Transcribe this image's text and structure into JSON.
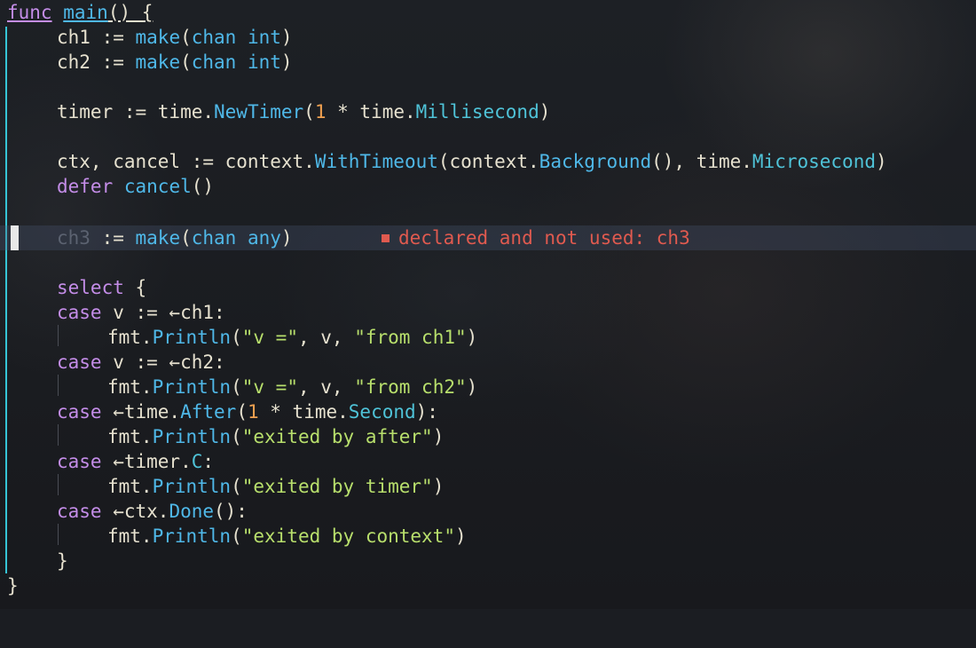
{
  "colors": {
    "background": "#1b1d22",
    "keyword": "#c48de8",
    "function": "#4fb8e8",
    "string": "#b8df6c",
    "number": "#f0a050",
    "error": "#e05a4f",
    "indent_guide": "#36c5d6",
    "current_line": "#3a4560"
  },
  "code": {
    "l0_kw": "func",
    "l0_fn": "main",
    "l0_rest": "() {",
    "l1_a": "ch1 := ",
    "l1_make": "make",
    "l1_b": "(",
    "l1_chan": "chan int",
    "l1_c": ")",
    "l2_a": "ch2 := ",
    "l2_make": "make",
    "l2_b": "(",
    "l2_chan": "chan int",
    "l2_c": ")",
    "l4_a": "timer := time.",
    "l4_fn": "NewTimer",
    "l4_b": "(",
    "l4_num": "1",
    "l4_c": " * time.",
    "l4_meth": "Millisecond",
    "l4_d": ")",
    "l6_a": "ctx, cancel := context.",
    "l6_fn": "WithTimeout",
    "l6_b": "(context.",
    "l6_fn2": "Background",
    "l6_c": "(), time.",
    "l6_meth": "Microsecond",
    "l6_d": ")",
    "l7_kw": "defer",
    "l7_fn": "cancel",
    "l7_rest": "()",
    "l9_unused": "ch3",
    "l9_a": " := ",
    "l9_make": "make",
    "l9_b": "(",
    "l9_chan": "chan any",
    "l9_c": ")",
    "l9_diag": "declared and not used: ch3",
    "l11_kw": "select",
    "l11_rest": " {",
    "l12_kw": "case",
    "l12_rest": " v := ←ch1:",
    "l13_a": "fmt.",
    "l13_fn": "Println",
    "l13_b": "(",
    "l13_s1": "\"v =\"",
    "l13_c": ", v, ",
    "l13_s2": "\"from ch1\"",
    "l13_d": ")",
    "l14_kw": "case",
    "l14_rest": " v := ←ch2:",
    "l15_a": "fmt.",
    "l15_fn": "Println",
    "l15_b": "(",
    "l15_s1": "\"v =\"",
    "l15_c": ", v, ",
    "l15_s2": "\"from ch2\"",
    "l15_d": ")",
    "l16_kw": "case",
    "l16_a": " ←time.",
    "l16_fn": "After",
    "l16_b": "(",
    "l16_num": "1",
    "l16_c": " * time.",
    "l16_meth": "Second",
    "l16_d": "):",
    "l17_a": "fmt.",
    "l17_fn": "Println",
    "l17_b": "(",
    "l17_s": "\"exited by after\"",
    "l17_c": ")",
    "l18_kw": "case",
    "l18_a": " ←timer.",
    "l18_meth": "C",
    "l18_b": ":",
    "l19_a": "fmt.",
    "l19_fn": "Println",
    "l19_b": "(",
    "l19_s": "\"exited by timer\"",
    "l19_c": ")",
    "l20_kw": "case",
    "l20_a": " ←ctx.",
    "l20_fn": "Done",
    "l20_b": "():",
    "l21_a": "fmt.",
    "l21_fn": "Println",
    "l21_b": "(",
    "l21_s": "\"exited by context\"",
    "l21_c": ")",
    "l22": "}",
    "l23": "}"
  }
}
